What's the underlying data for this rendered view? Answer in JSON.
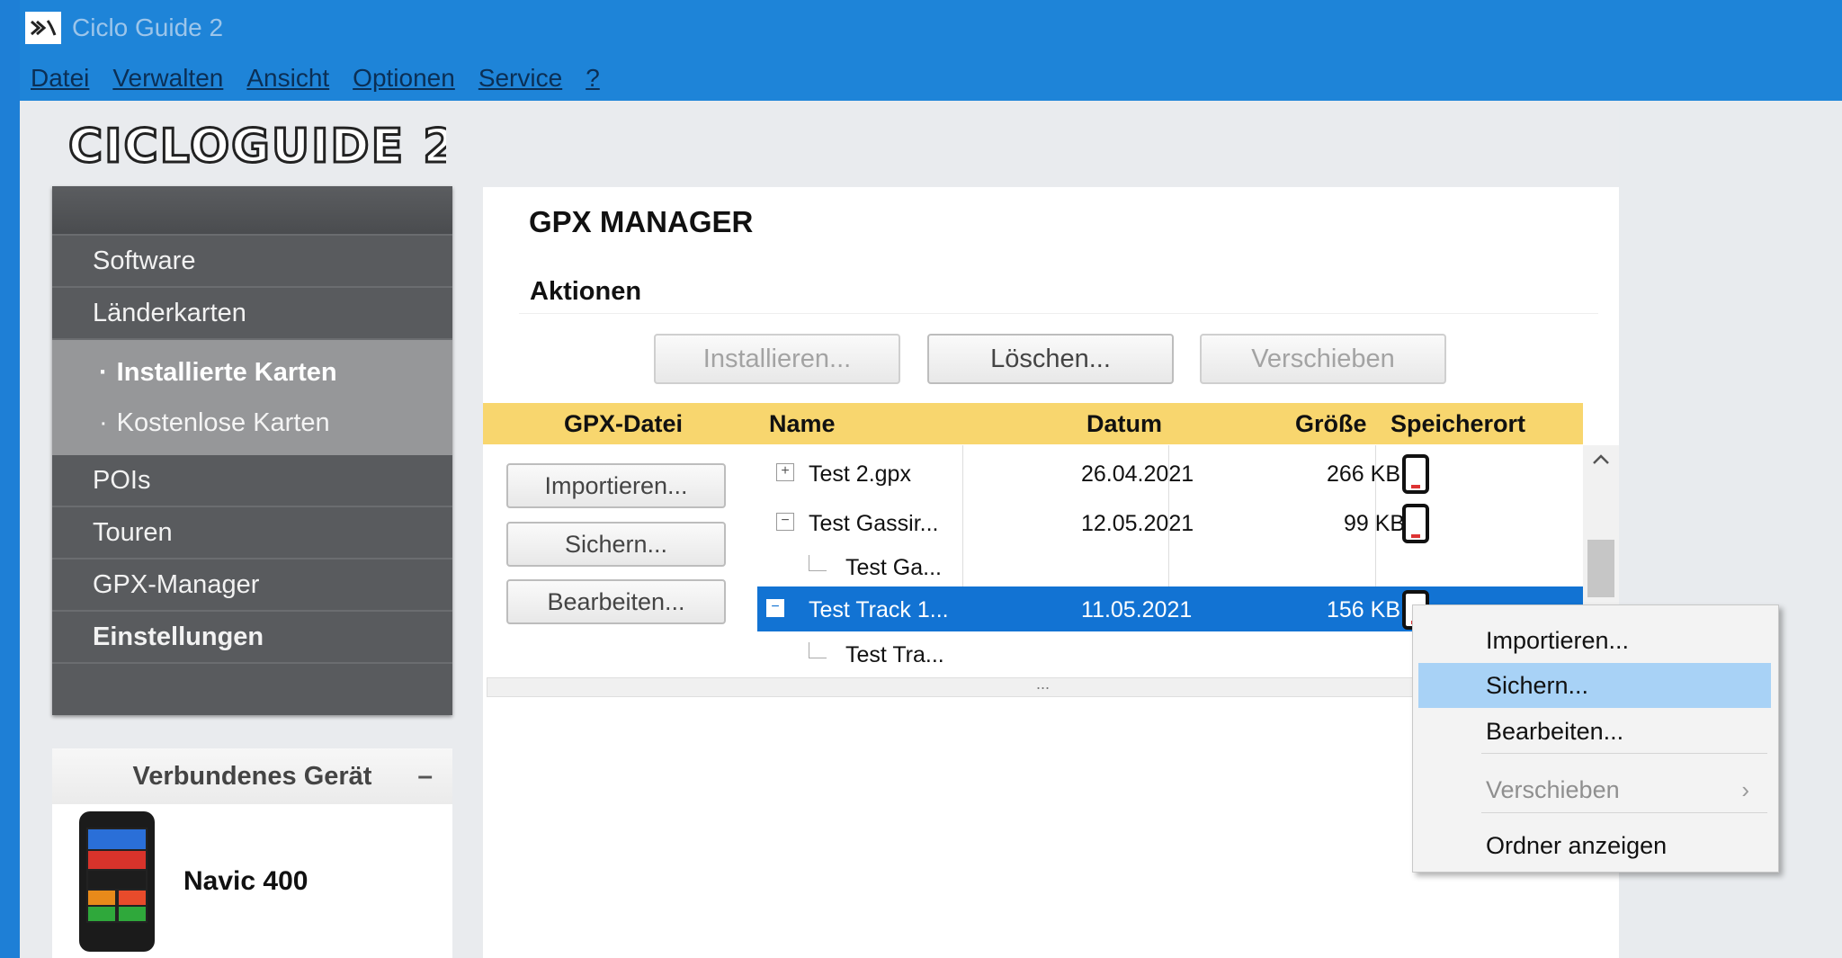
{
  "window": {
    "title": "Ciclo Guide 2"
  },
  "menu": [
    "Datei",
    "Verwalten",
    "Ansicht",
    "Optionen",
    "Service",
    "?"
  ],
  "logo": {
    "text": "CICLOGUIDE 2"
  },
  "sidebar": {
    "items": [
      {
        "label": "Software"
      },
      {
        "label": "Länderkarten"
      }
    ],
    "subitems": [
      {
        "label": "Installierte Karten",
        "active": true
      },
      {
        "label": "Kostenlose Karten",
        "active": false
      }
    ],
    "items_after": [
      {
        "label": "POIs"
      },
      {
        "label": "Touren"
      },
      {
        "label": "GPX-Manager"
      },
      {
        "label": "Einstellungen",
        "bold": true
      }
    ]
  },
  "device_panel": {
    "title": "Verbundenes Gerät",
    "collapse": "–",
    "device_name": "Navic 400"
  },
  "gpx": {
    "title": "GPX MANAGER",
    "actions_label": "Aktionen",
    "buttons": {
      "install": "Installieren...",
      "delete": "Löschen...",
      "move": "Verschieben"
    },
    "columns": {
      "gpx_file": "GPX-Datei",
      "name": "Name",
      "date": "Datum",
      "size": "Größe",
      "location": "Speicherort"
    },
    "side_buttons": {
      "import": "Importieren...",
      "save": "Sichern...",
      "edit": "Bearbeiten..."
    },
    "rows": [
      {
        "expander": "+",
        "name": "Test 2.gpx",
        "date": "26.04.2021",
        "size": "266 KB",
        "device": true
      },
      {
        "expander": "−",
        "name": "Test Gassir...",
        "date": "12.05.2021",
        "size": "99 KB",
        "device": true
      },
      {
        "child": true,
        "name": "Test Ga..."
      },
      {
        "expander": "−",
        "name": "Test Track 1...",
        "date": "11.05.2021",
        "size": "156 KB",
        "device": true,
        "selected": true
      },
      {
        "child": true,
        "name": "Test Tra..."
      }
    ],
    "hscroll_grip": "..."
  },
  "context_menu": {
    "items": [
      {
        "label": "Importieren...",
        "state": "normal"
      },
      {
        "label": "Sichern...",
        "state": "hover"
      },
      {
        "label": "Bearbeiten...",
        "state": "normal"
      },
      {
        "label": "Verschieben",
        "state": "disabled",
        "submenu": true
      },
      {
        "label": "Ordner anzeigen",
        "state": "normal"
      }
    ]
  },
  "colors": {
    "titlebar": "#1e84d8",
    "header_yellow": "#f8d66e",
    "selection": "#1273d3",
    "sidebar": "#595b5e"
  }
}
